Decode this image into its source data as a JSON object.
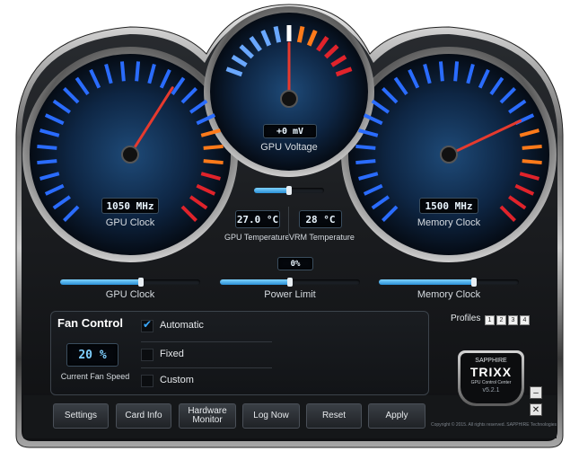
{
  "gauges": {
    "gpu_clock": {
      "readout": "1050 MHz",
      "label": "GPU Clock",
      "needle_fraction": 0.62
    },
    "gpu_voltage": {
      "readout": "+0 mV",
      "label": "GPU Voltage",
      "needle_fraction": 0.5
    },
    "memory_clock": {
      "readout": "1500 MHz",
      "label": "Memory Clock",
      "needle_fraction": 0.74
    }
  },
  "temps": {
    "gpu": {
      "value": "27.0 °C",
      "label": "GPU Temperature"
    },
    "vrm": {
      "value": "28 °C",
      "label": "VRM Temperature"
    }
  },
  "sliders": {
    "voltage": {
      "value": 0.5
    },
    "gpu_clock": {
      "label": "GPU Clock",
      "value": 0.58
    },
    "power_limit": {
      "label": "Power Limit",
      "readout": "0%",
      "value": 0.5
    },
    "memory_clock": {
      "label": "Memory Clock",
      "value": 0.68
    }
  },
  "fan": {
    "title": "Fan Control",
    "speed": "20 %",
    "speed_label": "Current Fan Speed",
    "options": [
      "Automatic",
      "Fixed",
      "Custom"
    ],
    "selected": 0
  },
  "profiles": {
    "label": "Profiles",
    "items": [
      "1",
      "2",
      "3",
      "4"
    ]
  },
  "buttons": {
    "settings": "Settings",
    "card_info": "Card Info",
    "hardware_monitor_1": "Hardware",
    "hardware_monitor_2": "Monitor",
    "log_now": "Log Now",
    "reset": "Reset",
    "apply": "Apply"
  },
  "logo": {
    "brand": "SAPPHIRE",
    "product": "TRIXX",
    "sub": "GPU Control Center",
    "version": "v5.2.1"
  },
  "copyright": "Copyright © 2015. All rights reserved. SAPPHIRE Technologies",
  "colors": {
    "accent": "#3aa8ff",
    "gauge_blue": "#2a6cff",
    "gauge_red": "#e0232b",
    "gauge_orange": "#ff7a1a",
    "needle": "#e63a2e"
  }
}
